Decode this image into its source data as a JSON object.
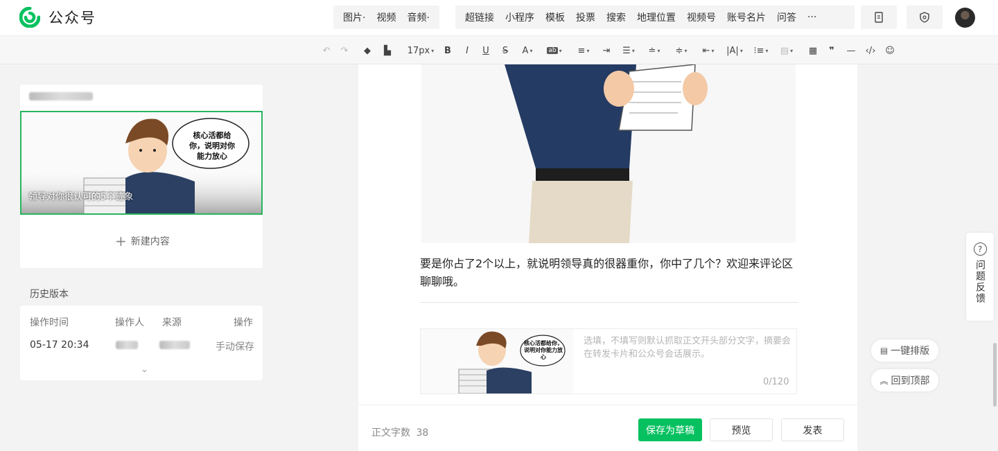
{
  "app": {
    "brand": "公众号"
  },
  "topnav": {
    "group1": [
      "图片·",
      "视频",
      "音频·"
    ],
    "group2": [
      "超链接",
      "小程序",
      "模板",
      "投票",
      "搜索",
      "地理位置",
      "视频号",
      "账号名片",
      "问答",
      "···"
    ]
  },
  "toolbar": {
    "font_size": "17px"
  },
  "left": {
    "cover_caption": "领导对你很认可的5个迹象",
    "comic_bubble": "核心活都给你，说明对你能力放心",
    "new_content": "新建内容",
    "history_title": "历史版本",
    "history_headers": [
      "操作时间",
      "操作人",
      "来源",
      "操作"
    ],
    "history_row": {
      "time": "05-17 20:34",
      "action": "手动保存"
    }
  },
  "editor": {
    "body_text": "要是你占了2个以上，就说明领导真的很器重你，你中了几个？欢迎来评论区聊聊哦。",
    "summary_placeholder": "选填，不填写则默认抓取正文开头部分文字，摘要会在转发卡片和公众号会话展示。",
    "summary_counter": "0/120",
    "word_count_label": "正文字数",
    "word_count": "38"
  },
  "actions": {
    "save_draft": "保存为草稿",
    "preview": "预览",
    "publish": "发表"
  },
  "side": {
    "feedback": "问题反馈",
    "one_click_format": "一键排版",
    "back_to_top": "回到顶部"
  },
  "colors": {
    "accent": "#07c160",
    "cover_border": "#27b55e"
  }
}
